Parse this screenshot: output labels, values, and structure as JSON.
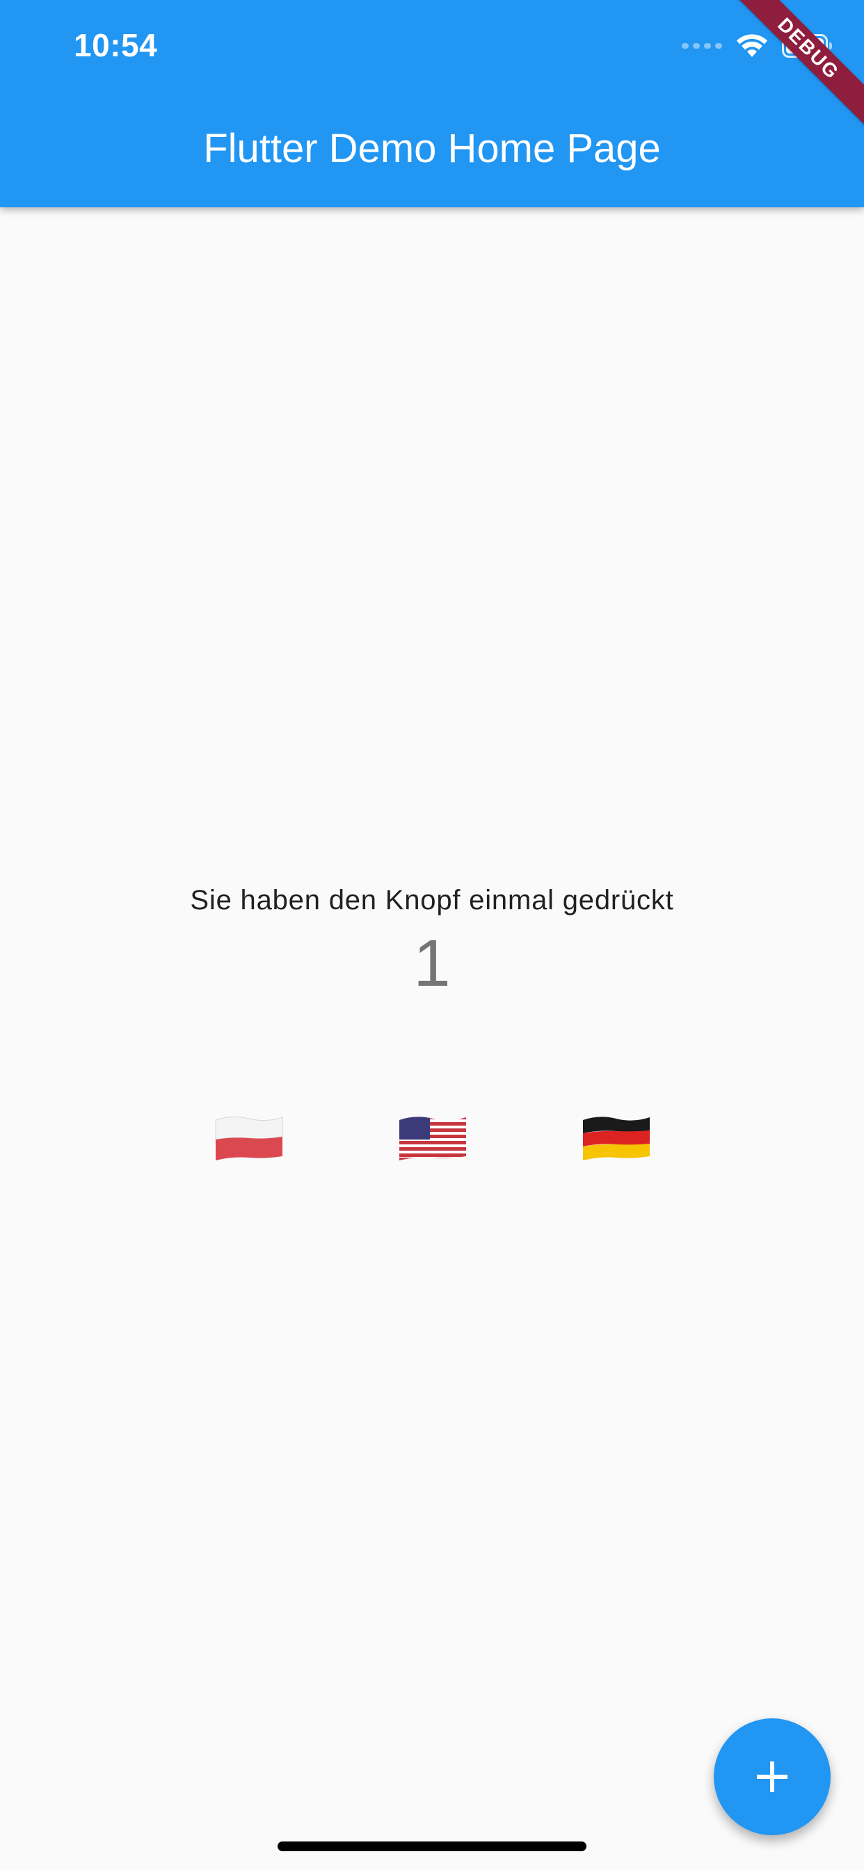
{
  "status_bar": {
    "time": "10:54",
    "icons": [
      "signal-icon",
      "wifi-icon",
      "battery-icon"
    ]
  },
  "app_bar": {
    "title": "Flutter Demo Home Page",
    "color": "#2196f3"
  },
  "debug_banner": {
    "label": "DEBUG",
    "color": "#8e1d3e"
  },
  "main": {
    "message": "Sie haben den Knopf einmal gedrückt",
    "counter": "1",
    "flags": [
      {
        "name": "poland-flag-icon"
      },
      {
        "name": "usa-flag-icon"
      },
      {
        "name": "germany-flag-icon"
      }
    ]
  },
  "fab": {
    "icon": "plus-icon"
  }
}
